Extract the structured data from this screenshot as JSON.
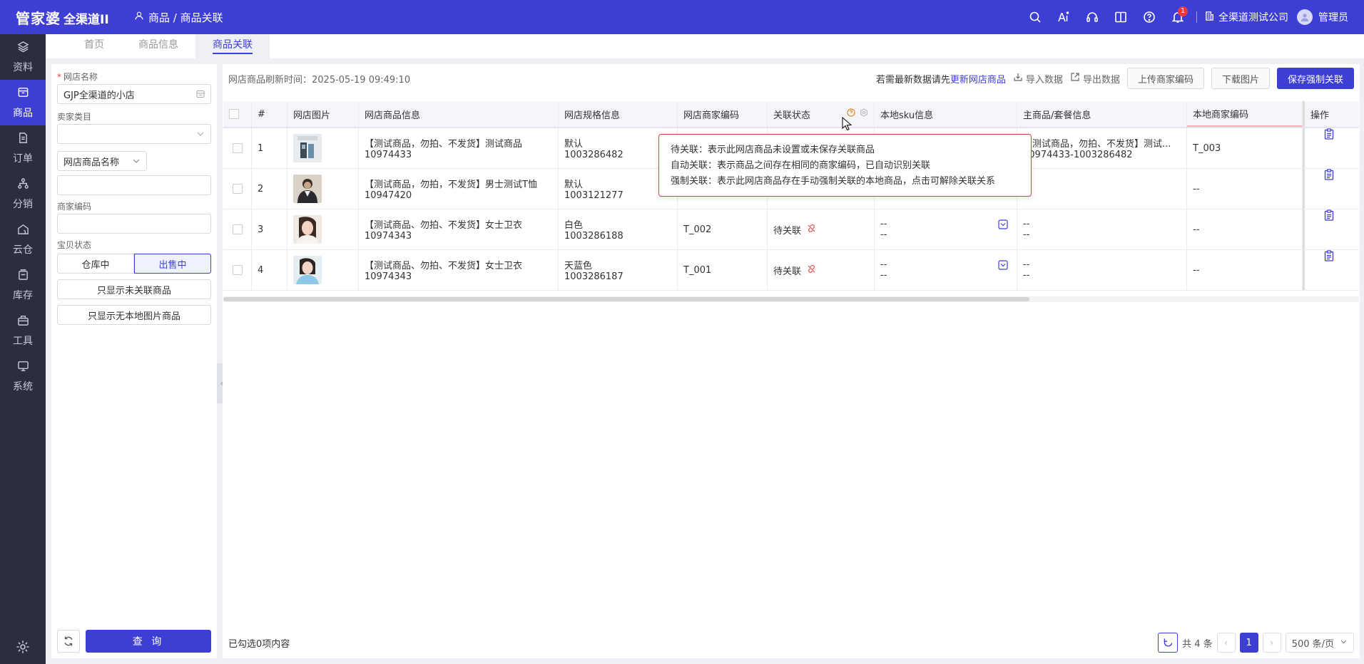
{
  "app": {
    "logo_main": "管家婆",
    "logo_sub": "全渠道II",
    "breadcrumb": "商品 / 商品关联",
    "notification_count": "1",
    "company": "全渠道测试公司",
    "user": "管理员"
  },
  "nav": {
    "items": [
      {
        "label": "资料",
        "icon": "layers-icon"
      },
      {
        "label": "商品",
        "icon": "product-icon"
      },
      {
        "label": "订单",
        "icon": "order-icon"
      },
      {
        "label": "分销",
        "icon": "distribution-icon"
      },
      {
        "label": "云仓",
        "icon": "cloud-warehouse-icon"
      },
      {
        "label": "库存",
        "icon": "inventory-icon"
      },
      {
        "label": "工具",
        "icon": "toolbox-icon"
      },
      {
        "label": "系统",
        "icon": "monitor-icon"
      }
    ],
    "active": "商品"
  },
  "tabs": [
    {
      "label": "首页"
    },
    {
      "label": "商品信息"
    },
    {
      "label": "商品关联",
      "active": true
    }
  ],
  "filter": {
    "shop_name_label": "网店名称",
    "shop_name_value": "GJP全渠道的小店",
    "seller_category_label": "卖家类目",
    "seller_category_value": "",
    "search_field_select": "网店商品名称",
    "search_value": "",
    "merchant_code_label": "商家编码",
    "merchant_code_value": "",
    "item_status_label": "宝贝状态",
    "status_options": [
      "仓库中",
      "出售中"
    ],
    "status_selected": "出售中",
    "only_unlinked": "只显示未关联商品",
    "only_no_local_image": "只显示无本地图片商品",
    "query_label": "查 询"
  },
  "toolbar": {
    "refresh_time_label": "网店商品刷新时间：",
    "refresh_time": "2025-05-19 09:49:10",
    "hint_prefix": "若需最新数据请先",
    "hint_link": "更新网店商品",
    "import_label": "导入数据",
    "export_label": "导出数据",
    "upload_code_label": "上传商家编码",
    "download_images_label": "下载图片",
    "save_force_label": "保存强制关联"
  },
  "table": {
    "headers": {
      "no": "#",
      "image": "网店图片",
      "info": "网店商品信息",
      "spec": "网店规格信息",
      "code": "网店商家编码",
      "status": "关联状态",
      "sku": "本地sku信息",
      "main": "主商品/套餐信息",
      "local_code": "本地商家编码",
      "op": "操作"
    },
    "rows": [
      {
        "no": "1",
        "name": "【测试商品，勿拍、不发货】测试商品",
        "id": "10974433",
        "spec": "默认",
        "spec_id": "1003286482",
        "code": "",
        "status": "",
        "sku1": "",
        "sku2": "",
        "main1": "【测试商品，勿拍、不发货】测试...",
        "main2": "10974433-1003286482",
        "local_code": "T_003"
      },
      {
        "no": "2",
        "name": "【测试商品，勿拍，不发货】男士测试T恤",
        "id": "10947420",
        "spec": "默认",
        "spec_id": "1003121277",
        "code": "",
        "status": "",
        "sku1": "",
        "sku2": "",
        "main1": "",
        "main2": "",
        "local_code": "--"
      },
      {
        "no": "3",
        "name": "【测试商品、勿拍、不发货】女士卫衣",
        "id": "10974343",
        "spec": "白色",
        "spec_id": "1003286188",
        "code": "T_002",
        "status": "待关联",
        "sku1": "--",
        "sku2": "--",
        "main1": "--",
        "main2": "--",
        "local_code": "--"
      },
      {
        "no": "4",
        "name": "【测试商品、勿拍、不发货】女士卫衣",
        "id": "10974343",
        "spec": "天蓝色",
        "spec_id": "1003286187",
        "code": "T_001",
        "status": "待关联",
        "sku1": "--",
        "sku2": "--",
        "main1": "--",
        "main2": "--",
        "local_code": "--"
      }
    ]
  },
  "tooltip": {
    "line1": "待关联：表示此网店商品未设置或未保存关联商品",
    "line2": "自动关联：表示商品之间存在相同的商家编码，已自动识别关联",
    "line3": "强制关联：表示此网店商品存在手动强制关联的本地商品，点击可解除关联关系"
  },
  "footer": {
    "selected_prefix": "已勾选",
    "selected_count": "0",
    "selected_suffix": "项内容",
    "total": "共 4 条",
    "current_page": "1",
    "page_size": "500 条/页"
  },
  "colors": {
    "primary": "#3d3fd4",
    "nav_bg": "#2c2e3f",
    "link_broken": "#e05050",
    "tooltip_border": "#e24040"
  }
}
